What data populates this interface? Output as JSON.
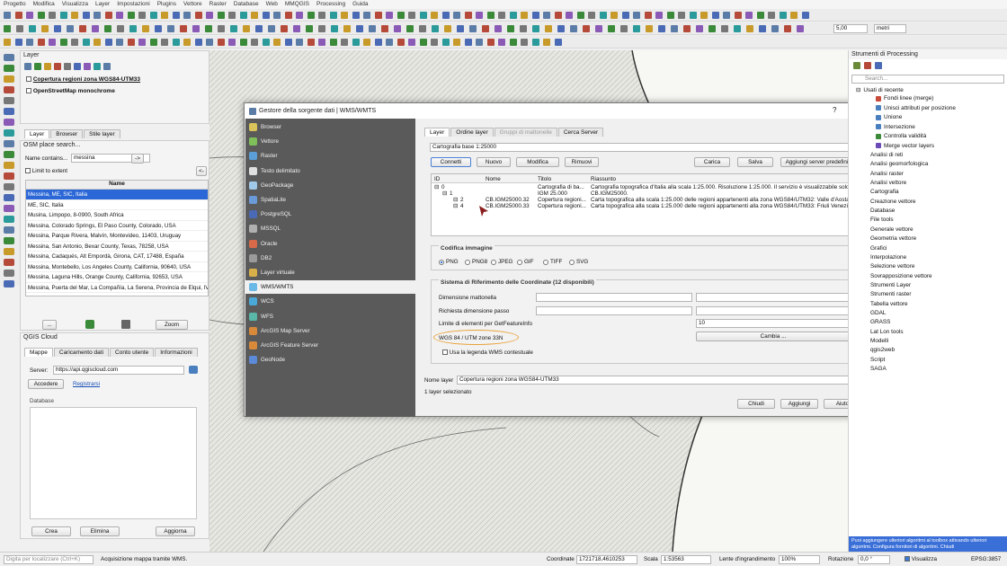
{
  "menubar": [
    "Progetto",
    "Modifica",
    "Visualizza",
    "Layer",
    "Impostazioni",
    "Plugins",
    "Vettore",
    "Raster",
    "Database",
    "Web",
    "MMQGIS",
    "Processing",
    "Guida"
  ],
  "toolbar": {
    "scale_value": "5,00",
    "units_value": "metri"
  },
  "layers_panel": {
    "title": "Layer",
    "items": [
      {
        "label": "Copertura regioni zona WGS84-UTM33",
        "checked": true
      },
      {
        "label": "OpenStreetMap monochrome",
        "checked": true
      }
    ],
    "tabs": [
      "Layer",
      "Browser",
      "Stile layer"
    ]
  },
  "osm": {
    "title": "OSM place search...",
    "name_label": "Name contains...",
    "name_value": "messina",
    "go": "->",
    "limit_label": "Limit to extent",
    "limit_btn": "<-",
    "col_header": "Name",
    "results": [
      "Messina, ME, SIC, Italia",
      "ME, SIC, Italia",
      "Musina, Limpopo, 8-0900, South Africa",
      "Messina, Colorado Springs, El Paso County, Colorado, USA",
      "Messina, Parque Rivera, Malvín, Montevideo, 11403, Uruguay",
      "Messina, San Antonio, Bexar County, Texas, 78258, USA",
      "Messina, Cadaqués, Alt Empordà, Girona, CAT, 17488, España",
      "Messina, Montebello, Los Angeles County, California, 90640, USA",
      "Messina, Laguna Hills, Orange County, California, 92653, USA",
      "Messina, Puerta del Mar, La Compañía, La Serena, Provincia de Elqui, IV"
    ],
    "dots": "...",
    "zoom": "Zoom"
  },
  "cloud": {
    "title": "QGIS Cloud",
    "tabs": [
      "Mappe",
      "Caricamento dati",
      "Conto utente",
      "Informazioni"
    ],
    "server_label": "Server:",
    "server_value": "https://api.qgiscloud.com",
    "login": "Accedere",
    "register": "Registrarsi",
    "db_label": "Database",
    "footer": [
      "Crea",
      "Elimina",
      "Aggiorna"
    ]
  },
  "dialog": {
    "title": "Gestore della sorgente dati | WMS/WMTS",
    "help": "?",
    "close": "×",
    "sources": [
      "Browser",
      "Vettore",
      "Raster",
      "Testo delimitato",
      "GeoPackage",
      "SpatiaLite",
      "PostgreSQL",
      "MSSQL",
      "Oracle",
      "DB2",
      "Layer virtuale",
      "WMS/WMTS",
      "WCS",
      "WFS",
      "ArcGIS Map Server",
      "ArcGIS Feature Server",
      "GeoNode"
    ],
    "tabs": [
      "Layer",
      "Ordine layer",
      "Gruppi di mattonelle",
      "Cerca Server"
    ],
    "connection": "Cartografia base 1:25000",
    "conn_buttons": [
      "Connetti",
      "Nuovo",
      "Modifica",
      "Rimuovi",
      "Carica",
      "Salva",
      "Aggiungi server predefiniti"
    ],
    "table_headers": [
      "ID",
      "Nome",
      "Titolo",
      "Riassunto"
    ],
    "rows": [
      [
        "0",
        "",
        "Cartografia di ba...",
        "Cartografia topografica d'Italia alla scala 1:25.000. Risoluzione 1:25.000. Il servizio è visualizzabile solo a sc..."
      ],
      [
        "1",
        "",
        "IGM 25.000",
        "CB.IGM25000."
      ],
      [
        "2",
        "CB.IGM25000.32",
        "Copertura regioni...",
        "Carta topografica alla scala 1:25.000 delle regioni appartenenti alla zona WGS84/UTM32: Valle d'Aosta..."
      ],
      [
        "4",
        "CB.IGM25000.33",
        "Copertura regioni...",
        "Carta topografica alla scala 1:25.000 delle regioni appartenenti alla zona WGS84/UTM33: Friuli Venezia..."
      ]
    ],
    "codifica_title": "Codifica immagine",
    "formats": [
      "PNG",
      "PNG8",
      "JPEG",
      "GIF",
      "TIFF",
      "SVG"
    ],
    "crs_title": "Sistema di Riferimento delle Coordinate (12 disponibili)",
    "fields": [
      "Dimensione mattonella",
      "Richiesta dimensione passo",
      "Limite di elementi per GetFeatureInfo"
    ],
    "feature_limit": "10",
    "crs_value": "WGS 84 / UTM zone 33N",
    "change": "Cambia ...",
    "legend_label": "Usa la legenda WMS contestuale",
    "layer_name_label": "Nome layer",
    "layer_name_value": "Copertura regioni zona WGS84-UTM33",
    "selected_count": "1 layer selezionato",
    "footer": [
      "Chiudi",
      "Aggiungi",
      "Aiuto"
    ],
    "highlight_color": "#e8a23a"
  },
  "processing": {
    "title": "Strumenti di Processing",
    "search_placeholder": "Search...",
    "recent": "Usati di recente",
    "recent_items": [
      "Fondi linee (merge)",
      "Unisci attributi per posizione",
      "Unione",
      "Intersezione",
      "Controlla validità",
      "Merge vector layers"
    ],
    "groups": [
      "Analisi di reti",
      "Analisi geomorfologica",
      "Analisi raster",
      "Analisi vettore",
      "Cartografia",
      "Creazione vettore",
      "Database",
      "File tools",
      "Generale vettore",
      "Geometria vettore",
      "Grafici",
      "Interpolazione",
      "Selezione vettore",
      "Sovrapposizione vettore",
      "Strumenti Layer",
      "Strumenti raster",
      "Tabella vettore",
      "GDAL",
      "GRASS",
      "Lat Lon tools",
      "Modelli",
      "qgis2web",
      "Script",
      "SAGA"
    ],
    "tip": "Puoi aggiungere ulteriori algoritmi al toolbox attivando ulteriori algoritmi. Configura fornitori di algoritmi. Chiudi"
  },
  "statusbar": {
    "search_placeholder": "Digita per localizzare (Ctrl+K)",
    "message": "Acquisizione mappa tramite WMS.",
    "coord_label": "Coordinate",
    "coord_value": "1721718,4610253",
    "scale_label": "Scala",
    "scale_value": "1:53563",
    "magnifier_label": "Lente d'ingrandimento",
    "magnifier_value": "100%",
    "rotation_label": "Rotazione",
    "rotation_value": "0,0 °",
    "render_label": "Visualizza",
    "crs": "EPSG:3857"
  }
}
